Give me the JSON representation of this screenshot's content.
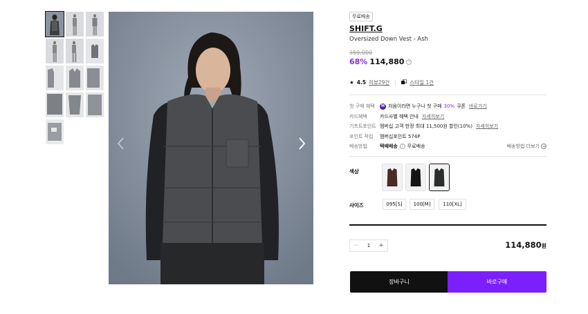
{
  "gallery": {
    "thumbnails": [
      "model-front",
      "model-side",
      "model-back",
      "model-full-1",
      "model-full-2",
      "vest-front",
      "vest-detail-1",
      "vest-detail-2",
      "vest-detail-3",
      "vest-detail-4",
      "vest-detail-5",
      "vest-detail-6",
      "fabric-detail"
    ],
    "active_index": 0
  },
  "product": {
    "badge": "무료배송",
    "brand": "SHIFT.G",
    "name": "Oversized Down Vest - Ash",
    "original_price": "359,000",
    "discount": "68%",
    "price": "114,880",
    "info_icon": "?"
  },
  "rating": {
    "star_icon": "★",
    "score": "4.5",
    "reviews_link": "리뷰29건",
    "style_link": "스타일 1건"
  },
  "benefits": {
    "first_purchase": {
      "label": "첫 구매 혜택",
      "icon": "M",
      "text_before": "처음이라면 누구나 첫 구매",
      "highlight": "30%",
      "text_after": "쿠폰",
      "link": "바로가기"
    },
    "card": {
      "label": "카드혜택",
      "text": "카드사별 혜택 안내",
      "link": "자세히보기"
    },
    "kids": {
      "label": "기프트포인트",
      "text": "멤버십 고객 한정 최대 11,500원 할인(10%)",
      "link": "자세히보기"
    },
    "points": {
      "label": "포인트 적립",
      "text": "멤버십포인트 574P"
    },
    "shipping": {
      "label": "배송방법",
      "method": "택배배송",
      "info_icon": "?",
      "fee": "무료배송",
      "more": "배송방법 더보기"
    }
  },
  "options": {
    "color_label": "색상",
    "colors": [
      {
        "name": "brown",
        "hex": "#4a2a22"
      },
      {
        "name": "black",
        "hex": "#151515"
      },
      {
        "name": "ash",
        "hex": "#2a2d2e"
      }
    ],
    "selected_color": 2,
    "size_label": "사이즈",
    "sizes": [
      "095[S]",
      "100[M]",
      "110[XL]"
    ]
  },
  "quantity": {
    "minus": "−",
    "value": "1",
    "plus": "+"
  },
  "total": {
    "amount": "114,880",
    "unit": "원"
  },
  "actions": {
    "cart": "장바구니",
    "buy": "바로구매"
  },
  "colors": {
    "accent": "#7b1fff",
    "discount": "#8a2be2",
    "dark": "#111111"
  }
}
